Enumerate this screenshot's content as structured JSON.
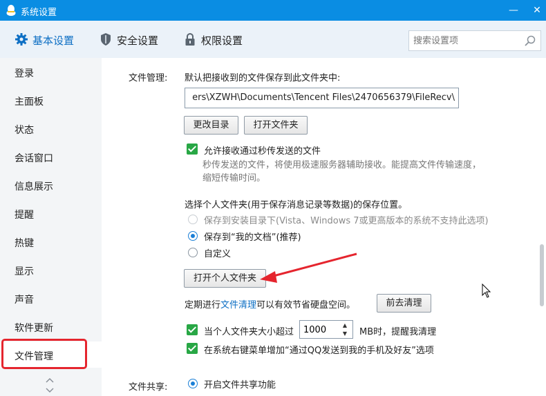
{
  "window": {
    "title": "系统设置",
    "minimize": "—",
    "close": "✕"
  },
  "tabs": [
    {
      "label": "基本设置",
      "icon": "gear-icon",
      "active": true
    },
    {
      "label": "安全设置",
      "icon": "shield-icon"
    },
    {
      "label": "权限设置",
      "icon": "lock-icon"
    }
  ],
  "search": {
    "placeholder": "搜索设置项",
    "value": ""
  },
  "sidebar": {
    "items": [
      {
        "label": "登录"
      },
      {
        "label": "主面板"
      },
      {
        "label": "状态"
      },
      {
        "label": "会话窗口"
      },
      {
        "label": "信息展示"
      },
      {
        "label": "提醒"
      },
      {
        "label": "热键"
      },
      {
        "label": "显示"
      },
      {
        "label": "声音"
      },
      {
        "label": "软件更新"
      },
      {
        "label": "文件管理",
        "active": true
      }
    ],
    "scroll_glyph": "︿\n﹀"
  },
  "file_mgmt": {
    "section_label": "文件管理:",
    "default_save_text": "默认把接收到的文件保存到此文件夹中:",
    "path_value": "ers\\XZWH\\Documents\\Tencent Files\\2470656379\\FileRecv\\",
    "change_dir_button": "更改目录",
    "open_folder_button": "打开文件夹",
    "allow_instant_label": "允许接收通过秒传发送的文件",
    "allow_instant_desc": "秒传发送的文件，将使用极速服务器辅助接收。能提高文件传输速度，缩短传输时间。",
    "personal_folder_text": "选择个人文件夹(用于保存消息记录等数据)的保存位置。",
    "radio_install_dir": "保存到安装目录下(Vista、Windows 7或更高版本的系统不支持此选项)",
    "radio_my_docs": "保存到“我的文档”(推荐)",
    "radio_custom": "自定义",
    "open_personal_button": "打开个人文件夹",
    "cleanup_prefix": "定期进行",
    "cleanup_link": "文件清理",
    "cleanup_suffix": "可以有效节省硬盘空间。",
    "cleanup_button": "前去清理",
    "size_check_prefix": "当个人文件夹大小超过",
    "size_value": "1000",
    "size_check_suffix": "MB时，提醒我清理",
    "context_menu_label": "在系统右键菜单增加“通过QQ发送到我的手机及好友”选项"
  },
  "file_share": {
    "section_label": "文件共享:",
    "enable_label": "开启文件共享功能"
  },
  "colors": {
    "titlebar": "#0a8de3",
    "accent": "#0d6fc4",
    "checkbox": "#28a745",
    "highlight": "#e5252e"
  }
}
